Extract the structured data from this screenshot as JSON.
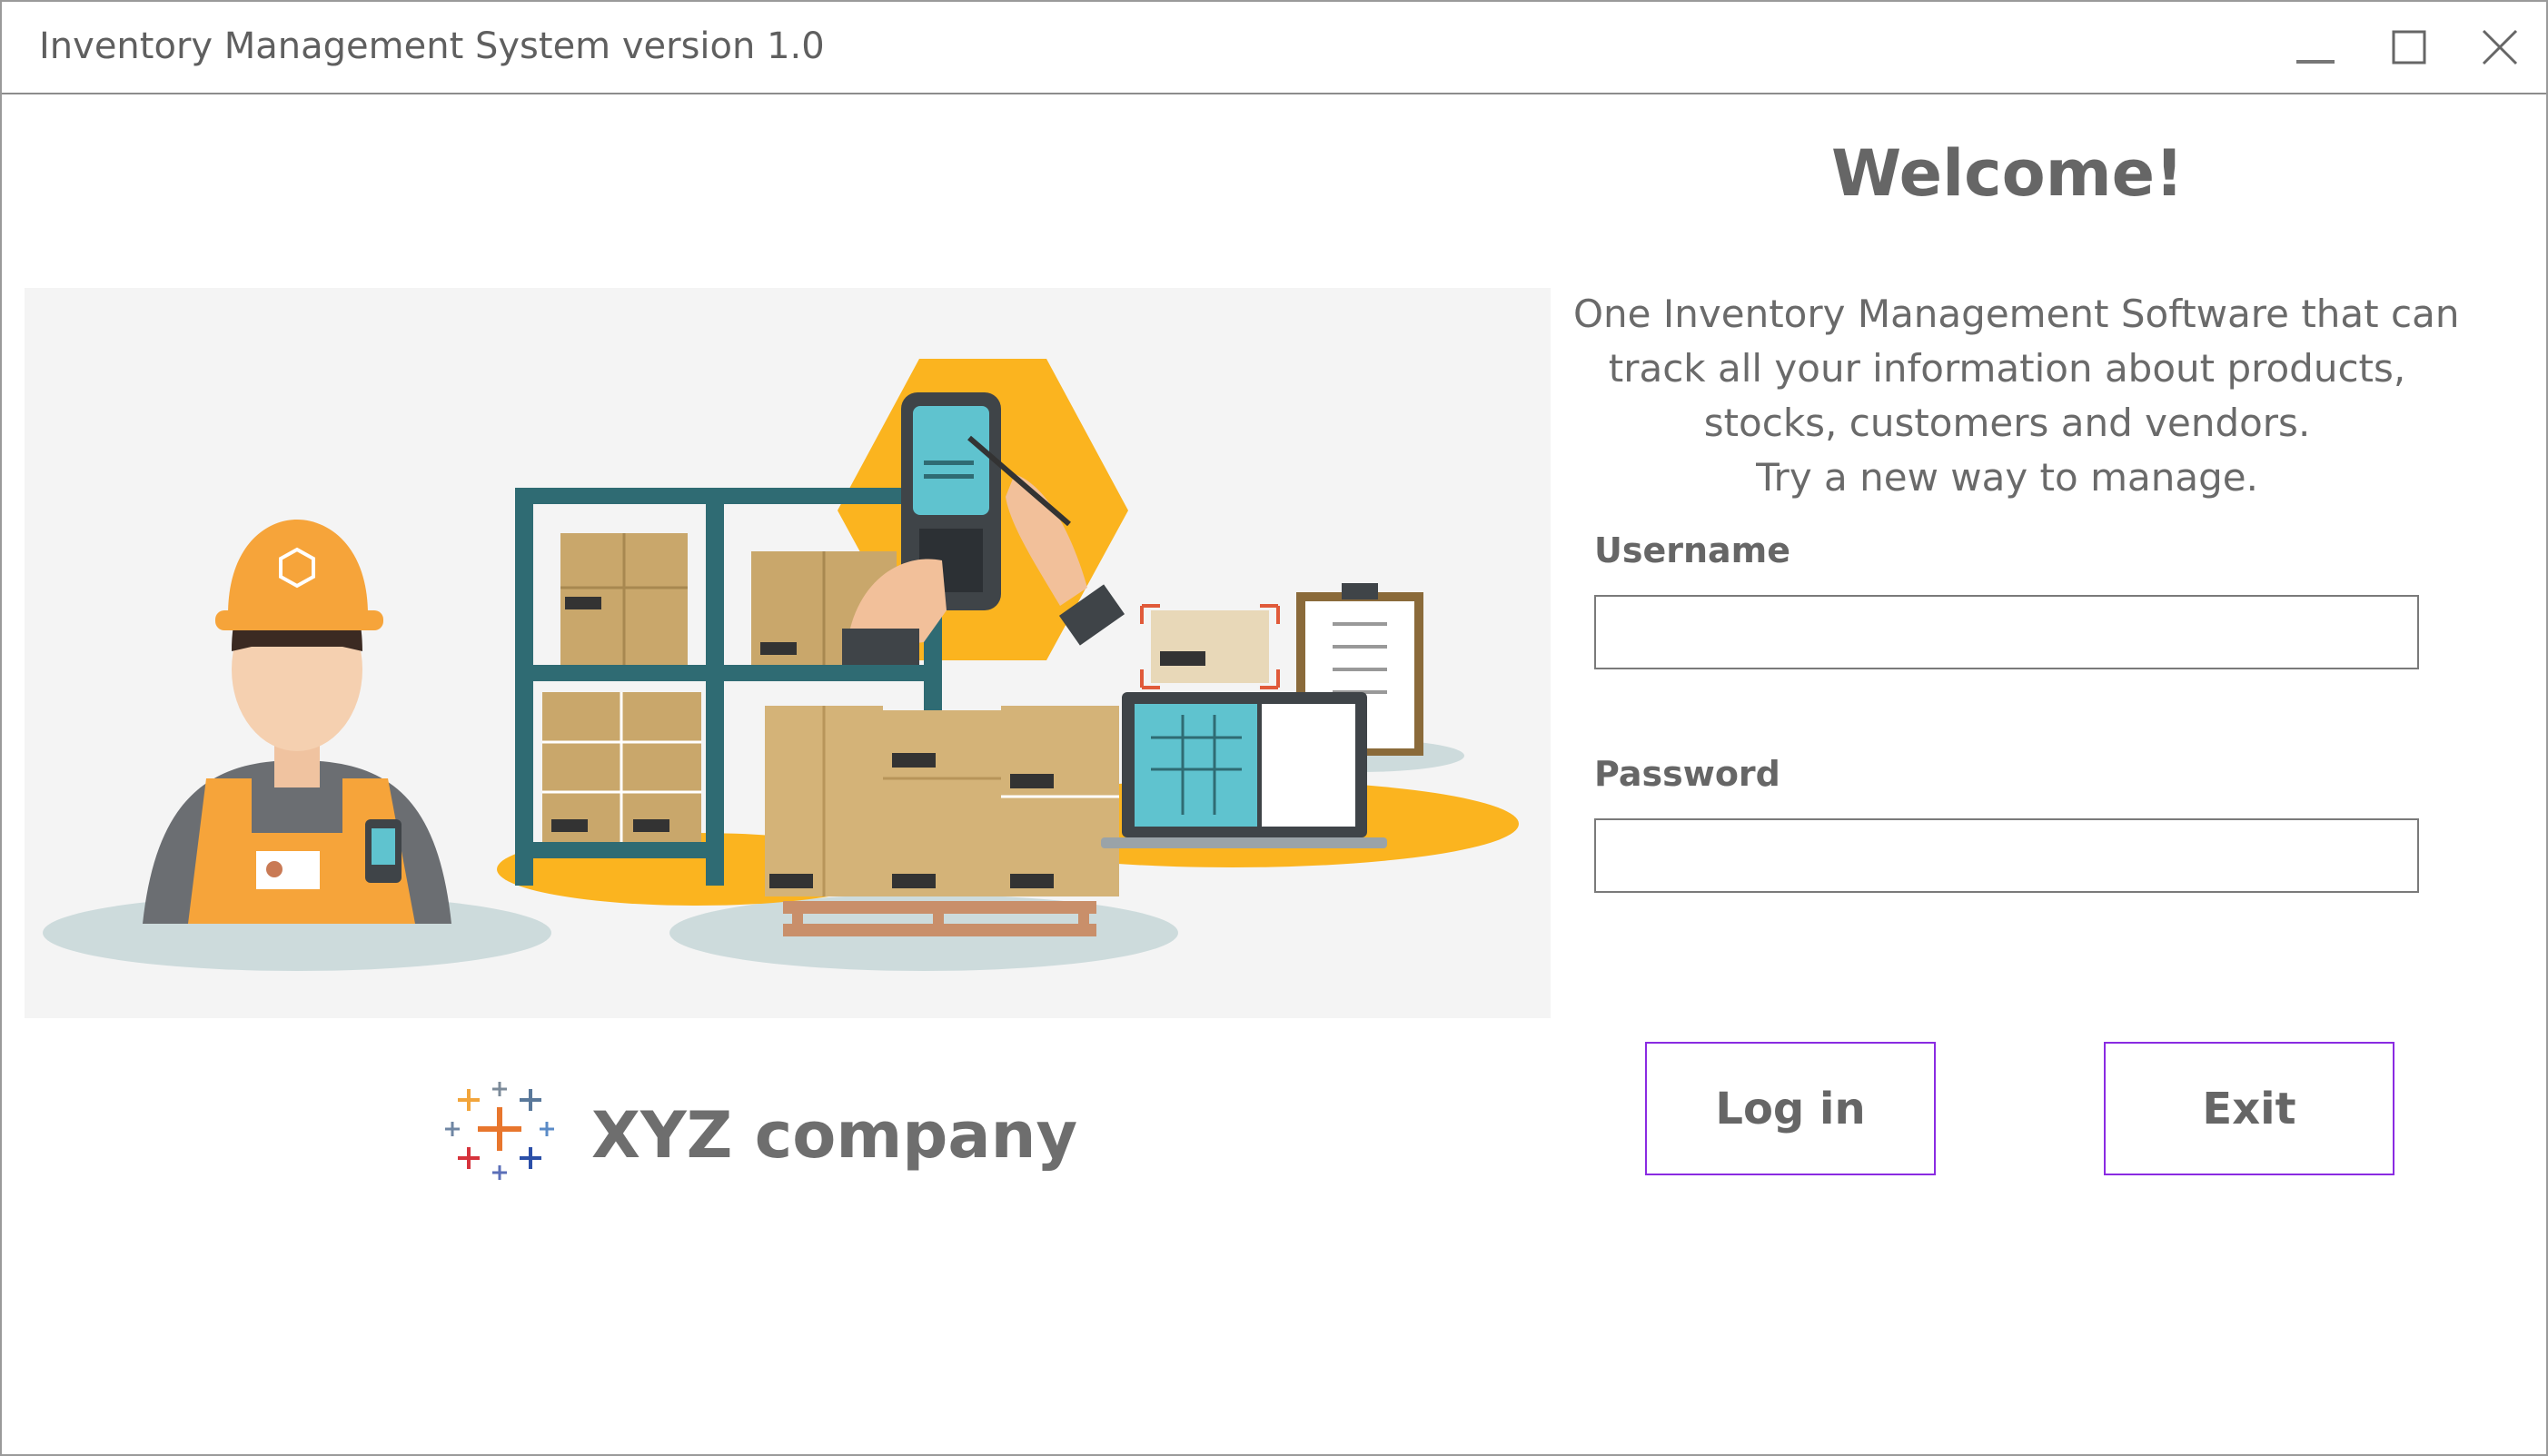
{
  "window": {
    "title": "Inventory Management System version 1.0",
    "controls": [
      "minimize-icon",
      "maximize-icon",
      "close-icon"
    ]
  },
  "hero": {
    "illustration": "warehouse-worker-illustration",
    "colors": {
      "accent_yellow": "#fbb41f",
      "shelf": "#2f6b73",
      "box": "#c9a76b",
      "shadow": "#cddbdc"
    }
  },
  "company": {
    "name": "XYZ company",
    "logo": "cross-mark-logo"
  },
  "login": {
    "heading": "Welcome!",
    "description": [
      "One Inventory Management Software that can",
      "track all your information about products,",
      "stocks, customers and vendors.",
      "Try a new way to manage."
    ],
    "username_label": "Username",
    "username_value": "",
    "password_label": "Password",
    "password_value": "",
    "login_button": "Log in",
    "exit_button": "Exit"
  },
  "colors": {
    "button_border": "#8a2be2",
    "text_gray": "#666666"
  }
}
